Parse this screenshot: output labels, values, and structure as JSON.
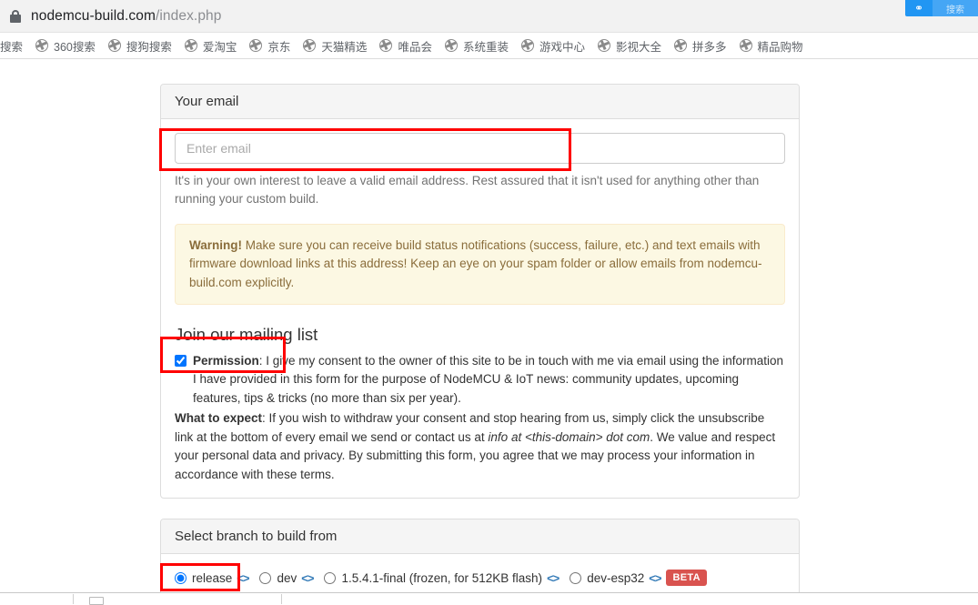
{
  "browser": {
    "lock_icon": "lock-icon",
    "url_domain": "nodemcu-build.com",
    "url_path": "/index.php",
    "baidu_logo": "baidu-paw-icon",
    "baidu_label": "搜索"
  },
  "bookmarks": [
    {
      "label": "搜索",
      "icon": "globe-icon"
    },
    {
      "label": "360搜索",
      "icon": "globe-icon"
    },
    {
      "label": "搜狗搜索",
      "icon": "globe-icon"
    },
    {
      "label": "爱淘宝",
      "icon": "globe-icon"
    },
    {
      "label": "京东",
      "icon": "globe-icon"
    },
    {
      "label": "天猫精选",
      "icon": "globe-icon"
    },
    {
      "label": "唯品会",
      "icon": "globe-icon"
    },
    {
      "label": "系统重装",
      "icon": "globe-icon"
    },
    {
      "label": "游戏中心",
      "icon": "globe-icon"
    },
    {
      "label": "影视大全",
      "icon": "globe-icon"
    },
    {
      "label": "拼多多",
      "icon": "globe-icon"
    },
    {
      "label": "精品购物",
      "icon": "globe-icon"
    }
  ],
  "email_panel": {
    "heading": "Your email",
    "input_placeholder": "Enter email",
    "input_value": "",
    "help_text": "It's in your own interest to leave a valid email address. Rest assured that it isn't used for anything other than running your custom build.",
    "warning": {
      "strong": "Warning!",
      "text": " Make sure you can receive build status notifications (success, failure, etc.) and text emails with firmware download links at this address! Keep an eye on your spam folder or allow emails from nodemcu-build.com explicitly."
    },
    "mailing_list": {
      "title": "Join our mailing list",
      "permission_checked": true,
      "permission_strong": "Permission",
      "permission_text": ": I give my consent to the owner of this site to be in touch with me via email using the information I have provided in this form for the purpose of NodeMCU & IoT news: community updates, upcoming features, tips & tricks (no more than six per year).",
      "expect_strong": "What to expect",
      "expect_text_1": ": If you wish to withdraw your consent and stop hearing from us, simply click the unsubscribe link at the bottom of every email we send or contact us at ",
      "expect_italic": "info at <this-domain> dot com",
      "expect_text_2": ". We value and respect your personal data and privacy. By submitting this form, you agree that we may process your information in accordance with these terms."
    }
  },
  "branch_panel": {
    "heading": "Select branch to build from",
    "code_icon_label": "<>",
    "options": [
      {
        "label": "release",
        "selected": true,
        "code_link": true,
        "badge": ""
      },
      {
        "label": "dev",
        "selected": false,
        "code_link": true,
        "badge": ""
      },
      {
        "label": "1.5.4.1-final (frozen, for 512KB flash)",
        "selected": false,
        "code_link": true,
        "badge": ""
      },
      {
        "label": "dev-esp32",
        "selected": false,
        "code_link": true,
        "badge": "BETA"
      }
    ]
  },
  "annotations": {
    "color": "#ff0000",
    "boxes": [
      {
        "name": "email-input-highlight"
      },
      {
        "name": "permission-checkbox-highlight"
      },
      {
        "name": "release-radio-highlight"
      }
    ]
  }
}
